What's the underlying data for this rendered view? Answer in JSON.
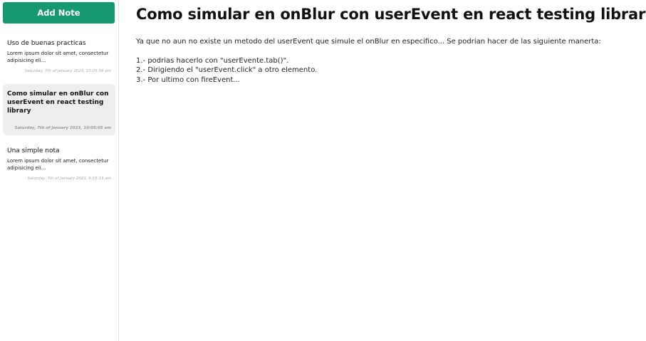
{
  "sidebar": {
    "add_note_label": "Add Note",
    "notes": [
      {
        "title": "Uso de buenas practicas",
        "excerpt": "Lorem ipsum dolor sit amet, consectetur adipisicing eli...",
        "date": "Saturday, 7th of January 2023, 10:05:56 am",
        "active": false
      },
      {
        "title": "Como simular en onBlur con userEvent en react testing library",
        "excerpt": "",
        "date": "Saturday, 7th of January 2023, 10:05:05 am",
        "active": true
      },
      {
        "title": "Una simple nota",
        "excerpt": "Lorem ipsum dolor sit amet, consectetur adipisicing eli...",
        "date": "Saturday, 7th of January 2023, 9:55:13 am",
        "active": false
      }
    ]
  },
  "main": {
    "heading": "Como simular en onBlur con userEvent en react testing library",
    "intro": "Ya que no aun no existe un metodo del userEvent que simule el onBlur en especifico... Se podrian hacer de las siguiente manerta:",
    "lines": [
      "1.- podrias hacerlo con \"userEvente.tab()\".",
      "2.- Dirigiendo el \"userEvent.click\" a otro elemento.",
      "3.- Por ultimo con fireEvent..."
    ]
  },
  "colors": {
    "accent": "#169971",
    "active_bg": "#eeeeee",
    "date_text": "#a8a8a8"
  }
}
